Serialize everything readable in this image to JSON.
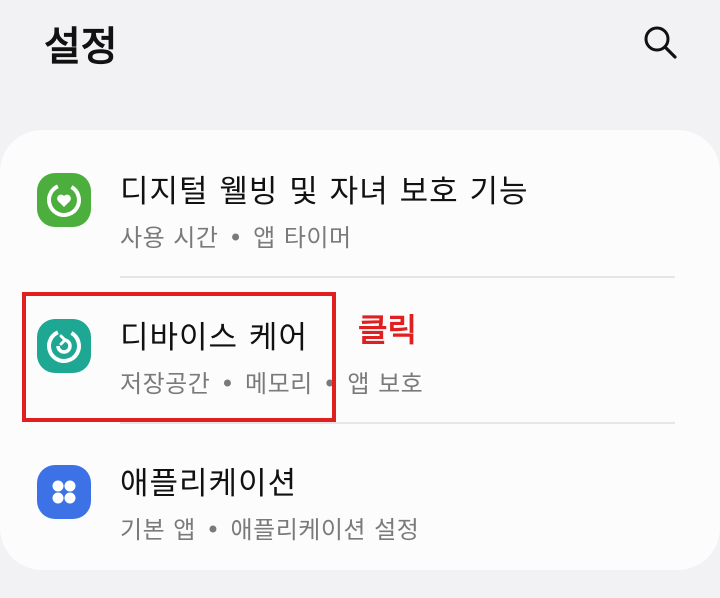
{
  "header": {
    "title": "설정",
    "search_icon": "search-icon"
  },
  "settings_items": [
    {
      "title": "디지털 웰빙 및 자녀 보호 기능",
      "subtitle_parts": [
        "사용 시간",
        "앱 타이머"
      ],
      "icon": "digital-wellbeing-icon",
      "icon_color": "#4cae3c"
    },
    {
      "title": "디바이스 케어",
      "subtitle_parts": [
        "저장공간",
        "메모리",
        "앱 보호"
      ],
      "icon": "device-care-icon",
      "icon_color": "#1ea894"
    },
    {
      "title": "애플리케이션",
      "subtitle_parts": [
        "기본 앱",
        "애플리케이션 설정"
      ],
      "icon": "apps-icon",
      "icon_color": "#3d72e6"
    }
  ],
  "separator": "•",
  "annotation": {
    "label": "클릭",
    "color": "#e02020"
  }
}
